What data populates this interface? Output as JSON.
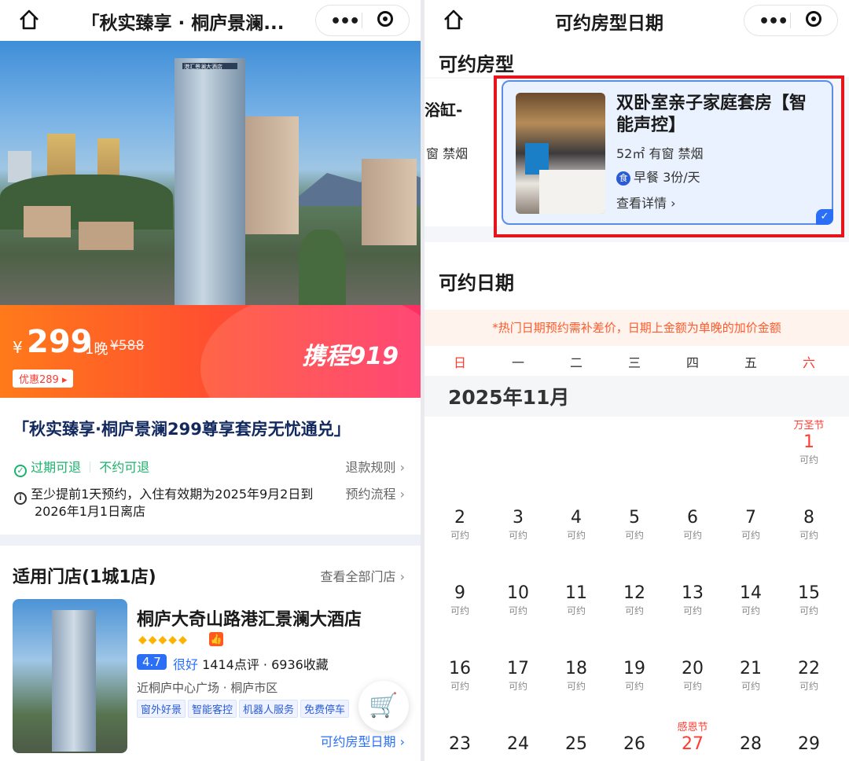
{
  "left": {
    "nav": {
      "title": "「秋实臻享 · 桐庐景澜..."
    },
    "hero": {
      "sign": "港汇景澜大酒店"
    },
    "price": {
      "currency": "¥",
      "amount": "299",
      "per": "1晚",
      "original": "¥588",
      "coupon": "优惠289 ▸",
      "brand": "携程919"
    },
    "offer": {
      "title": "「秋实臻享·桐庐景澜299尊享套房无忧通兑」",
      "refund_a": "过期可退",
      "refund_b": "不约可退",
      "refund_rule": "退款规则",
      "notice_line1": "至少提前1天预约，入住有效期为2025年9月2日到",
      "notice_line2": "2026年1月1日离店",
      "booking_flow": "预约流程"
    },
    "stores": {
      "section_title": "适用门店(1城1店)",
      "view_all": "查看全部门店",
      "hotel": {
        "name": "桐庐大奇山路港汇景澜大酒店",
        "diamonds": "◆◆◆◆◆",
        "score": "4.7",
        "rating_word": "很好",
        "reviews": "1414点评 · 6936收藏",
        "address": "近桐庐中心广场 · 桐庐市区",
        "tags": [
          "窗外好景",
          "智能客控",
          "机器人服务",
          "免费停车"
        ],
        "room_link": "可约房型日期"
      }
    }
  },
  "right": {
    "nav": {
      "title": "可约房型日期"
    },
    "room_section_title": "可约房型",
    "prev_room": {
      "title": "浴缸-",
      "desc": "窗 禁烟"
    },
    "room": {
      "name": "双卧室亲子家庭套房【智能声控】",
      "meta": "52㎡ 有窗 禁烟",
      "meal_icon": "食",
      "meal": "早餐 3份/天",
      "detail": "查看详情"
    },
    "date_section_title": "可约日期",
    "notice": "*热门日期预约需补差价，日期上金额为单晚的加价金额",
    "weekdays": [
      "日",
      "一",
      "二",
      "三",
      "四",
      "五",
      "六"
    ],
    "month": "2025年11月",
    "weeks": [
      [
        null,
        null,
        null,
        null,
        null,
        null,
        {
          "d": "1",
          "s": "可约",
          "h": "万圣节"
        }
      ],
      [
        {
          "d": "2",
          "s": "可约"
        },
        {
          "d": "3",
          "s": "可约"
        },
        {
          "d": "4",
          "s": "可约"
        },
        {
          "d": "5",
          "s": "可约"
        },
        {
          "d": "6",
          "s": "可约"
        },
        {
          "d": "7",
          "s": "可约"
        },
        {
          "d": "8",
          "s": "可约"
        }
      ],
      [
        {
          "d": "9",
          "s": "可约"
        },
        {
          "d": "10",
          "s": "可约"
        },
        {
          "d": "11",
          "s": "可约"
        },
        {
          "d": "12",
          "s": "可约"
        },
        {
          "d": "13",
          "s": "可约"
        },
        {
          "d": "14",
          "s": "可约"
        },
        {
          "d": "15",
          "s": "可约"
        }
      ],
      [
        {
          "d": "16",
          "s": "可约"
        },
        {
          "d": "17",
          "s": "可约"
        },
        {
          "d": "18",
          "s": "可约"
        },
        {
          "d": "19",
          "s": "可约"
        },
        {
          "d": "20",
          "s": "可约"
        },
        {
          "d": "21",
          "s": "可约"
        },
        {
          "d": "22",
          "s": "可约"
        }
      ],
      [
        {
          "d": "23",
          "s": ""
        },
        {
          "d": "24",
          "s": ""
        },
        {
          "d": "25",
          "s": ""
        },
        {
          "d": "26",
          "s": ""
        },
        {
          "d": "27",
          "s": "",
          "h": "感恩节"
        },
        {
          "d": "28",
          "s": ""
        },
        {
          "d": "29",
          "s": ""
        }
      ]
    ]
  },
  "colors": {
    "accent_blue": "#2a6ff6",
    "holiday_red": "#ff3b30",
    "highlight_red": "#e8141b",
    "refund_green": "#1bb36b"
  },
  "icons": [
    "home-icon",
    "more-icon",
    "record-icon",
    "check-circle-icon",
    "info-icon",
    "chevron-right-icon",
    "cart-icon",
    "meal-icon",
    "selected-check-icon"
  ]
}
